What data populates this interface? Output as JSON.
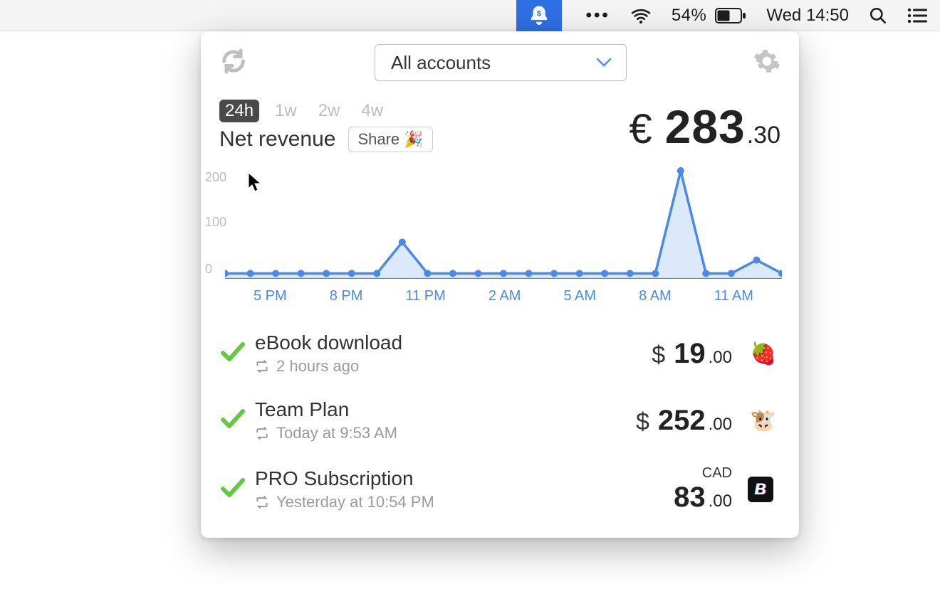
{
  "menubar": {
    "battery_pct": "54%",
    "clock": "Wed 14:50"
  },
  "header": {
    "account_selector_label": "All accounts"
  },
  "ranges": {
    "items": [
      "24h",
      "1w",
      "2w",
      "4w"
    ],
    "active_index": 0
  },
  "metric": {
    "title": "Net revenue",
    "share_label": "Share",
    "currency_symbol": "€",
    "amount_whole": "283",
    "amount_decimal": ".30"
  },
  "chart_data": {
    "type": "area",
    "title": "Net revenue",
    "ylabel": "",
    "xlabel": "",
    "ylim": [
      0,
      230
    ],
    "y_ticks": [
      0,
      100,
      200
    ],
    "x_tick_labels": [
      "5 PM",
      "8 PM",
      "11 PM",
      "2 AM",
      "5 AM",
      "8 AM",
      "11 AM"
    ],
    "categories": [
      "3 PM",
      "4 PM",
      "5 PM",
      "6 PM",
      "7 PM",
      "8 PM",
      "9 PM",
      "10 PM",
      "11 PM",
      "12 AM",
      "1 AM",
      "2 AM",
      "3 AM",
      "4 AM",
      "5 AM",
      "6 AM",
      "7 AM",
      "8 AM",
      "9 AM",
      "10 AM",
      "11 AM",
      "12 PM",
      "1 PM"
    ],
    "series": [
      {
        "name": "Net revenue",
        "values": [
          0,
          0,
          0,
          0,
          0,
          0,
          0,
          70,
          0,
          0,
          0,
          0,
          0,
          0,
          0,
          0,
          0,
          0,
          230,
          0,
          0,
          30,
          0
        ]
      }
    ]
  },
  "transactions": [
    {
      "title": "eBook download",
      "subtitle": "2 hours ago",
      "currency_symbol": "$",
      "currency_code": "",
      "amount_whole": "19",
      "amount_decimal": ".00",
      "icon": "🍓",
      "icon_name": "strawberry-icon"
    },
    {
      "title": "Team Plan",
      "subtitle": "Today at 9:53 AM",
      "currency_symbol": "$",
      "currency_code": "",
      "amount_whole": "252",
      "amount_decimal": ".00",
      "icon": "🐮",
      "icon_name": "cow-icon"
    },
    {
      "title": "PRO Subscription",
      "subtitle": "Yesterday at 10:54 PM",
      "currency_symbol": "",
      "currency_code": "CAD",
      "amount_whole": "83",
      "amount_decimal": ".00",
      "icon": "B",
      "icon_name": "b-badge-icon"
    }
  ]
}
